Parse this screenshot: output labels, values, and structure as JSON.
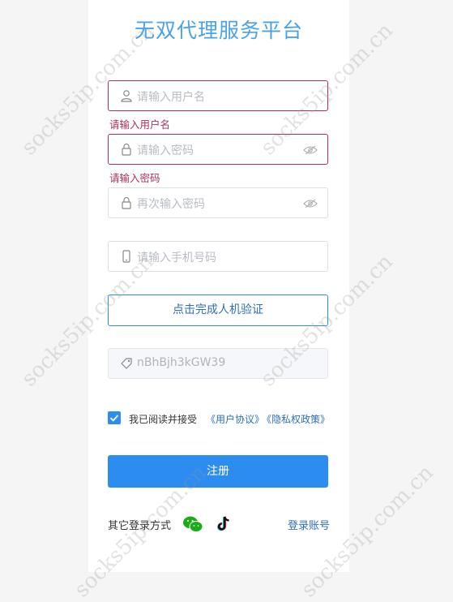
{
  "title": "无双代理服务平台",
  "fields": {
    "username": {
      "placeholder": "请输入用户名",
      "error": "请输入用户名"
    },
    "password": {
      "placeholder": "请输入密码",
      "error": "请输入密码"
    },
    "confirm": {
      "placeholder": "再次输入密码"
    },
    "phone": {
      "placeholder": "请输入手机号码"
    },
    "invite": {
      "value": "nBhBjh3kGW39"
    }
  },
  "verify_label": "点击完成人机验证",
  "agreement": {
    "checked": true,
    "text": "我已阅读并接受",
    "user_link": "《用户协议》",
    "privacy_link": "《隐私权政策》"
  },
  "submit_label": "注册",
  "other_login_label": "其它登录方式",
  "login_link": "登录账号",
  "watermark": "socks5ip.com.cn",
  "colors": {
    "accent": "#2d8cf0",
    "error": "#a8315a",
    "title": "#4aa3e8"
  }
}
